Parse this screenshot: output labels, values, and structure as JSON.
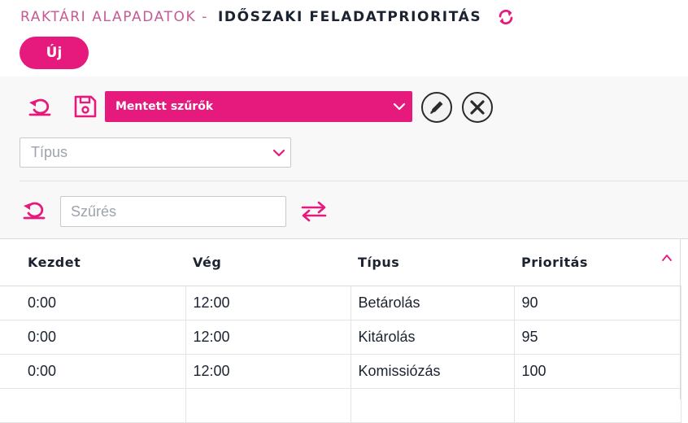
{
  "header": {
    "title_prefix": "RAKTÁRI ALAPADATOK -",
    "title_main": "IDŐSZAKI FELADATPRIORITÁS",
    "new_button_label": "Új"
  },
  "filters": {
    "saved_filters_label": "Mentett szűrők",
    "type_placeholder": "Típus",
    "filter_placeholder": "Szűrés"
  },
  "table": {
    "columns": [
      "Kezdet",
      "Vég",
      "Típus",
      "Prioritás"
    ],
    "rows": [
      [
        "0:00",
        "12:00",
        "Betárolás",
        "90"
      ],
      [
        "0:00",
        "12:00",
        "Kitárolás",
        "95"
      ],
      [
        "0:00",
        "12:00",
        "Komissiózás",
        "100"
      ]
    ]
  },
  "colors": {
    "accent": "#e6197c",
    "title_prefix": "#c65a93",
    "text": "#1b2330"
  },
  "icons": {
    "refresh": "refresh-icon",
    "reset": "reset-icon",
    "save": "save-icon",
    "edit": "pencil-icon",
    "delete": "close-icon",
    "swap": "swap-icon",
    "sort": "chevron-up-icon",
    "dropdown": "chevron-down-icon"
  }
}
